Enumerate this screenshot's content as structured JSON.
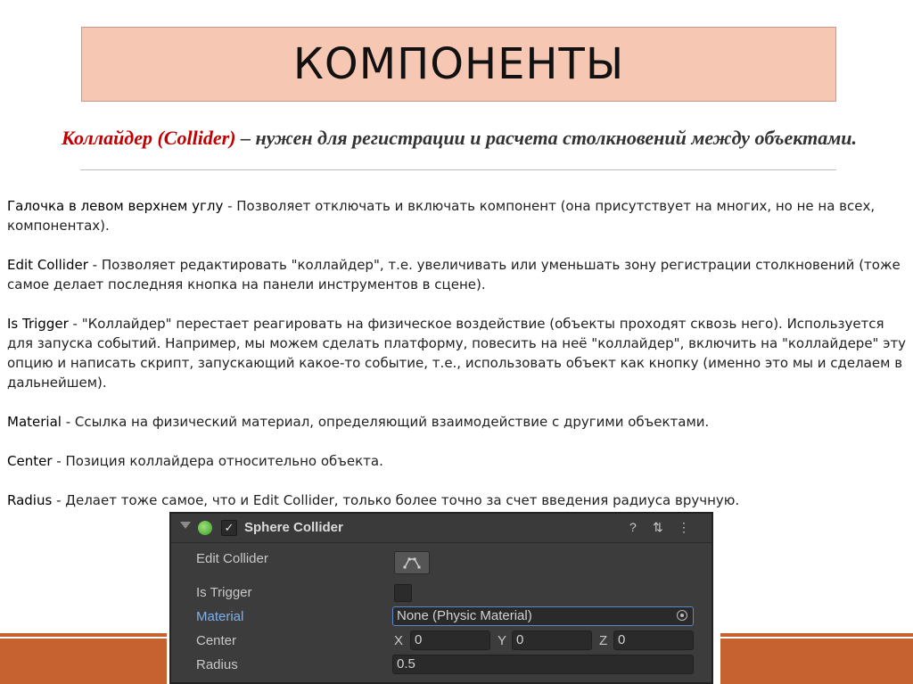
{
  "title": "КОМПОНЕНТЫ",
  "subtitle": {
    "term": "Коллайдер (Collider)",
    "rest": " – нужен для регистрации и расчета столкновений между объектами."
  },
  "paragraphs": [
    {
      "term": "Галочка в левом верхнем углу",
      "text": " - Позволяет отключать и включать компонент (она присутствует на многих, но не на всех, компонентах)."
    },
    {
      "term": "Edit Collider",
      "text": " - Позволяет редактировать \"коллайдер\", т.е. увеличивать или уменьшать зону регистрации столкновений (тоже самое делает последняя кнопка на панели инструментов в сцене)."
    },
    {
      "term": "Is Trigger",
      "text": " - \"Коллайдер\" перестает реагировать на физическое воздействие (объекты проходят сквозь него). Используется для запуска событий. Например, мы можем сделать платформу, повесить на неё \"коллайдер\", включить на \"коллайдере\" эту опцию и написать скрипт, запускающий какое-то событие, т.е., использовать объект как кнопку (именно это мы и сделаем в дальнейшем)."
    },
    {
      "term": "Material",
      "text": " - Ссылка на физический материал, определяющий взаимодействие с другими объектами."
    },
    {
      "term": "Center",
      "text": " - Позиция коллайдера относительно объекта."
    },
    {
      "term": "Radius",
      "text": " - Делает тоже самое, что и Edit Collider, только более точно за счет введения радиуса вручную."
    }
  ],
  "inspector": {
    "component_name": "Sphere Collider",
    "enabled_check": "✓",
    "help_icon": "?",
    "settings_icon": "⇅",
    "menu_icon": "⋮",
    "labels": {
      "edit_collider": "Edit Collider",
      "is_trigger": "Is Trigger",
      "material": "Material",
      "center": "Center",
      "radius": "Radius"
    },
    "material_value": "None (Physic Material)",
    "center": {
      "x_label": "X",
      "x": "0",
      "y_label": "Y",
      "y": "0",
      "z_label": "Z",
      "z": "0"
    },
    "radius_value": "0.5",
    "is_trigger_checked": false
  },
  "colors": {
    "title_bg": "#f6c7b2",
    "accent_red": "#c00000",
    "deco_orange": "#c5622f",
    "panel_bg": "#3c3c3c",
    "material_label_blue": "#7fb0ea"
  }
}
